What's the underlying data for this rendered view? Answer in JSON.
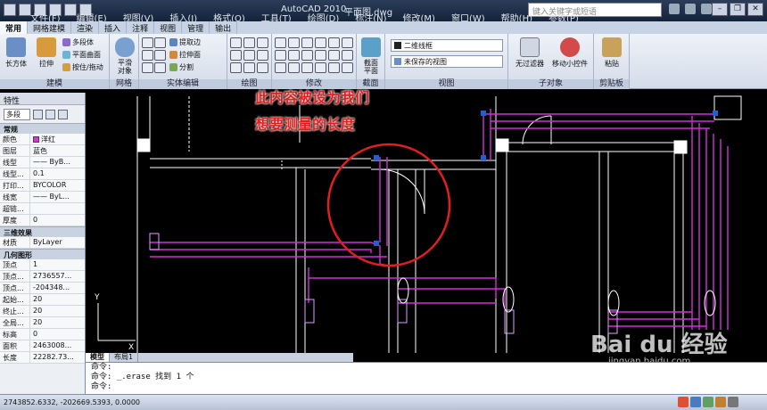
{
  "titlebar": {
    "app_title": "AutoCAD 2010",
    "doc_title": "平面图.dwg",
    "search_placeholder": "键入关键字或短语"
  },
  "menubar": [
    "文件(F)",
    "编辑(E)",
    "视图(V)",
    "插入(I)",
    "格式(O)",
    "工具(T)",
    "绘图(D)",
    "标注(N)",
    "修改(M)",
    "窗口(W)",
    "帮助(H)",
    "参数(P)"
  ],
  "ribbon_tabs": [
    "常用",
    "网格建模",
    "渲染",
    "插入",
    "注释",
    "视图",
    "管理",
    "输出"
  ],
  "ribbon": {
    "box_label": "长方体",
    "extrude_label": "拉伸",
    "polysolid_label": "多段体",
    "planar_label": "平面曲面",
    "presspull_label": "按住/拖动",
    "modeling_group": "建模",
    "smooth_label": "平滑\n对象",
    "mesh_group": "网格",
    "extract_label": "提取边",
    "extrude_face_label": "拉伸面",
    "split_label": "分割",
    "solid_edit_group": "实体编辑",
    "draw_group": "绘图",
    "modify_group": "修改",
    "section_plane_label": "截面\n平面",
    "section_group": "截面",
    "visual_style": "二维线框",
    "saved_view": "未保存的视图",
    "view_group": "视图",
    "no_filter_label": "无过滤器",
    "gizmo_label": "移动小控件",
    "subobject_group": "子对象",
    "paste_label": "粘贴",
    "clipboard_group": "剪贴板"
  },
  "palette": {
    "title": "特性",
    "selector": "多段",
    "sections": {
      "general": "常规",
      "3d": "三维效果",
      "geometry": "几何图形"
    },
    "general_rows": [
      {
        "k": "颜色",
        "v": "洋红"
      },
      {
        "k": "图层",
        "v": "蓝色"
      },
      {
        "k": "线型",
        "v": "—— ByB..."
      },
      {
        "k": "线型...",
        "v": "0.1"
      },
      {
        "k": "打印...",
        "v": "BYCOLOR"
      },
      {
        "k": "线宽",
        "v": "—— ByL..."
      },
      {
        "k": "超链...",
        "v": ""
      },
      {
        "k": "厚度",
        "v": "0"
      }
    ],
    "material_rows": [
      {
        "k": "材质",
        "v": "ByLayer"
      }
    ],
    "geometry_rows": [
      {
        "k": "顶点",
        "v": "1"
      },
      {
        "k": "顶点...",
        "v": "2736557..."
      },
      {
        "k": "顶点...",
        "v": "-204348..."
      },
      {
        "k": "起始...",
        "v": "20"
      },
      {
        "k": "终止...",
        "v": "20"
      },
      {
        "k": "全局...",
        "v": "20"
      },
      {
        "k": "标高",
        "v": "0"
      },
      {
        "k": "面积",
        "v": "2463008..."
      },
      {
        "k": "长度",
        "v": "22282.73..."
      }
    ]
  },
  "annotation": {
    "line1": "此内容被设为我们",
    "line2": "想要测量的长度"
  },
  "layout_tabs": [
    "模型",
    "布局1"
  ],
  "command_lines": [
    "命令:",
    "命令:  _.erase 找到 1 个",
    "命令:",
    "命令:"
  ],
  "status": {
    "coords": "2743852.6332, -202669.5393, 0.0000"
  },
  "watermark": {
    "text": "Bai du 经验",
    "sub": "jingyan.baidu.com"
  }
}
